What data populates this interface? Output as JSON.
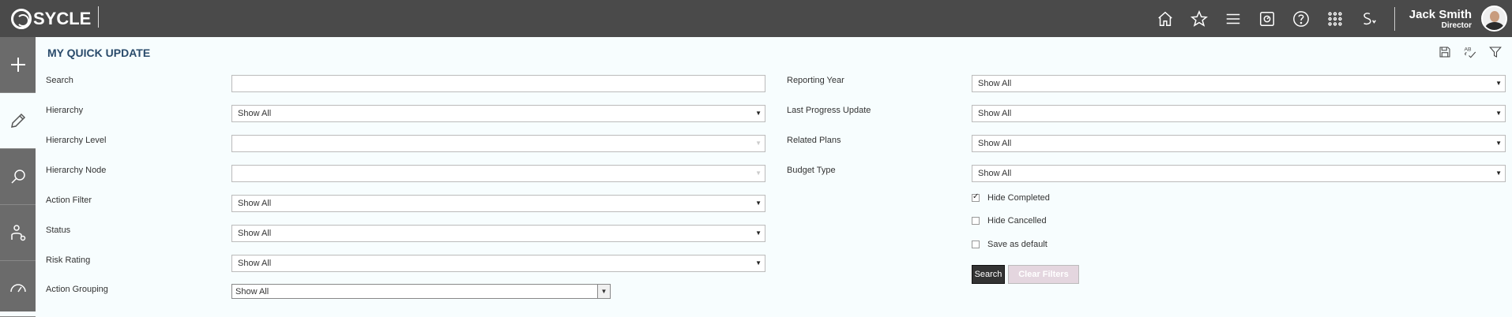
{
  "brand": {
    "name": "SYCLE"
  },
  "header": {
    "icons": [
      "home-icon",
      "star-icon",
      "menu-icon",
      "dashboard-icon",
      "help-icon",
      "apps-grid-icon",
      "sycle-switch-icon"
    ],
    "user_name": "Jack Smith",
    "user_role": "Director"
  },
  "sidebar": {
    "items": [
      "add-icon",
      "edit-icon",
      "search-icon",
      "user-settings-icon",
      "gauge-icon"
    ],
    "active": 1
  },
  "page": {
    "title": "MY QUICK UPDATE",
    "tools": [
      "save-icon",
      "spellcheck-icon",
      "filter-icon"
    ]
  },
  "form": {
    "search_label": "Search",
    "search_value": "",
    "hierarchy_label": "Hierarchy",
    "hierarchy_value": "Show All",
    "hierarchy_level_label": "Hierarchy Level",
    "hierarchy_level_value": "",
    "hierarchy_node_label": "Hierarchy Node",
    "hierarchy_node_value": "",
    "action_filter_label": "Action Filter",
    "action_filter_value": "Show All",
    "status_label": "Status",
    "status_value": "Show All",
    "risk_rating_label": "Risk Rating",
    "risk_rating_value": "Show All",
    "action_grouping_label": "Action Grouping",
    "action_grouping_value": "Show All",
    "reporting_year_label": "Reporting Year",
    "reporting_year_value": "Show All",
    "last_progress_label": "Last Progress Update",
    "last_progress_value": "Show All",
    "related_plans_label": "Related Plans",
    "related_plans_value": "Show All",
    "budget_type_label": "Budget Type",
    "budget_type_value": "Show All",
    "hide_completed_label": "Hide Completed",
    "hide_completed_checked": true,
    "hide_cancelled_label": "Hide Cancelled",
    "hide_cancelled_checked": false,
    "save_default_label": "Save as default",
    "save_default_checked": false,
    "search_button": "Search",
    "clear_button": "Clear Filters"
  }
}
